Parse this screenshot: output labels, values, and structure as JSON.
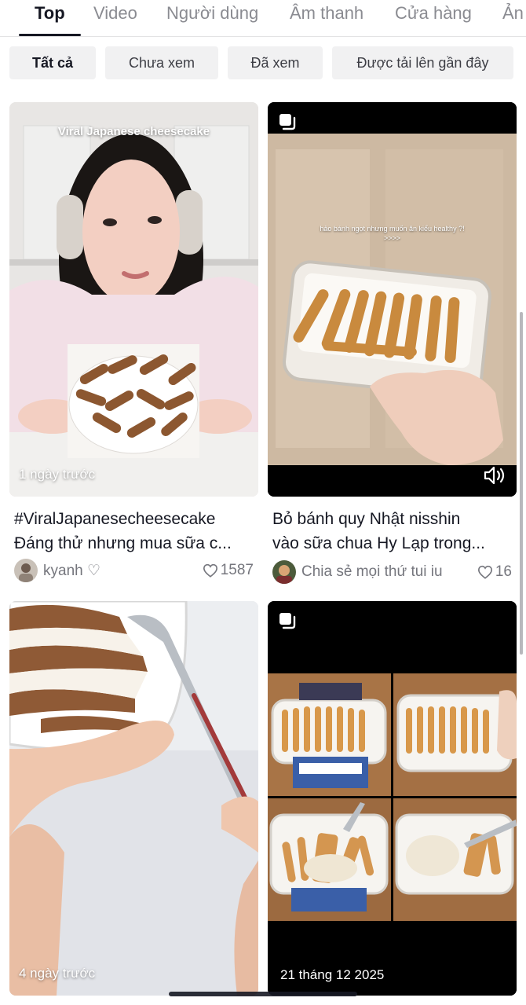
{
  "tabs": [
    {
      "label": "Top",
      "active": true
    },
    {
      "label": "Video"
    },
    {
      "label": "Người dùng"
    },
    {
      "label": "Âm thanh"
    },
    {
      "label": "Cửa hàng"
    },
    {
      "label": "Ản"
    }
  ],
  "filters": [
    {
      "label": "Tất cả",
      "active": true
    },
    {
      "label": "Chưa xem"
    },
    {
      "label": "Đã xem"
    },
    {
      "label": "Được tải lên gần đây"
    }
  ],
  "videos": [
    {
      "overlay_text": "Viral Japanese cheesecake",
      "date": "1 ngày trước",
      "caption_line1": "#ViralJapanesecheesecake",
      "caption_line2": "Đáng thử nhưng mua sữa c...",
      "author": "kyanh ♡",
      "likes": "1587"
    },
    {
      "overlay_text_line1": "hảo bánh ngọt nhưng muốn ăn kiểu healthy ?!",
      "overlay_text_line2": ">>>>",
      "caption_line1": "Bỏ bánh quy Nhật nisshin",
      "caption_line2": "vào sữa chua Hy Lạp trong...",
      "author": "Chia sẻ mọi thứ tui iu",
      "likes": "16"
    },
    {
      "date": "4 ngày trước"
    },
    {
      "date": "21 tháng 12 2025"
    }
  ],
  "colors": {
    "text": "#161823",
    "muted": "#8a8b91",
    "chip_bg": "#f1f1f2",
    "black": "#000000"
  }
}
